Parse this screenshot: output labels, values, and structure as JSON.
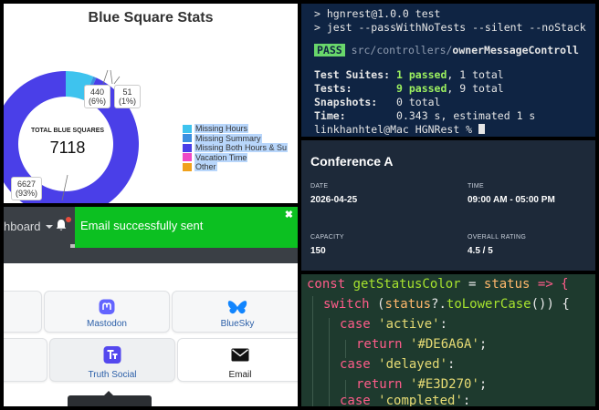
{
  "stats_panel": {
    "title": "Blue Square Stats",
    "total_label": "TOTAL BLUE SQUARES",
    "total_value": "7118",
    "callouts": {
      "both": {
        "count": "6627",
        "pct": "(93%)"
      },
      "hours": {
        "count": "440",
        "pct": "(6%)"
      },
      "summary": {
        "count": "51",
        "pct": "(1%)"
      }
    },
    "legend": [
      {
        "label": "Missing Hours",
        "color": "#3ec3ee"
      },
      {
        "label": "Missing Summary",
        "color": "#3b8fe0"
      },
      {
        "label": "Missing Both Hours & Su",
        "color": "#4a3fe8"
      },
      {
        "label": "Vacation Time",
        "color": "#ef48c6"
      },
      {
        "label": "Other",
        "color": "#f0a11c"
      }
    ]
  },
  "chart_data": {
    "type": "pie",
    "title": "Blue Square Stats",
    "donut": true,
    "center_label": "TOTAL BLUE SQUARES",
    "center_value": 7118,
    "categories": [
      "Missing Hours",
      "Missing Summary",
      "Missing Both Hours & Su",
      "Vacation Time",
      "Other"
    ],
    "values": [
      440,
      51,
      6627,
      0,
      0
    ],
    "percent_labels": [
      "(6%)",
      "(1%)",
      "(93%)",
      "",
      ""
    ],
    "colors": [
      "#3ec3ee",
      "#3b8fe0",
      "#4a3fe8",
      "#ef48c6",
      "#f0a11c"
    ],
    "legend_position": "right"
  },
  "terminal": {
    "line1": "> hgnrest@1.0.0 test",
    "line2": "> jest --passWithNoTests --silent --noStack",
    "pass_badge": "PASS",
    "test_path_dim": "src/controllers/",
    "test_path_bold": "ownerMessageControll",
    "suites_label": "Test Suites: ",
    "suites_passed": "1 passed",
    "suites_total": ", 1 total",
    "tests_label": "Tests:       ",
    "tests_passed": "9 passed",
    "tests_total": ", 9 total",
    "snapshots_label": "Snapshots:   ",
    "snapshots_value": "0 total",
    "time_label": "Time:        ",
    "time_value": "0.343 s, estimated 1 s",
    "prompt": "linkhanhtel@Mac HGNRest % "
  },
  "conference": {
    "title": "Conference A",
    "date_label": "DATE",
    "date_value": "2026-04-25",
    "time_label": "TIME",
    "time_value": "09:00 AM - 05:00 PM",
    "capacity_label": "CAPACITY",
    "capacity_value": "150",
    "rating_label": "OVERALL RATING",
    "rating_value": "4.5 / 5"
  },
  "code": {
    "l1_kw": "const ",
    "l1_fn": "getStatusColor",
    "l1_eq": " = ",
    "l1_var": "status",
    "l1_arrow": " => {",
    "l2_kw": "switch ",
    "l2_open": "(",
    "l2_var": "status",
    "l2_q": "?.",
    "l2_fn": "toLowerCase",
    "l2_close": "()) {",
    "l3_kw": "case ",
    "l3_str": "'active'",
    "l3_colon": ":",
    "l4_kw": "return ",
    "l4_str": "'#DE6A6A'",
    "l4_semi": ";",
    "l5_kw": "case ",
    "l5_str": "'delayed'",
    "l5_colon": ":",
    "l6_kw": "return ",
    "l6_str": "'#E3D270'",
    "l6_semi": ";",
    "l7_kw": "case ",
    "l7_str": "'completed'",
    "l7_colon": ":"
  },
  "dashboard": {
    "nav_text": "hboard",
    "toast_message": "Email successfully sent",
    "toast_close": "✖",
    "share_tiles": {
      "mastodon": "Mastodon",
      "bluesky": "BlueSky",
      "truth_social": "Truth Social",
      "email": "Email"
    }
  }
}
